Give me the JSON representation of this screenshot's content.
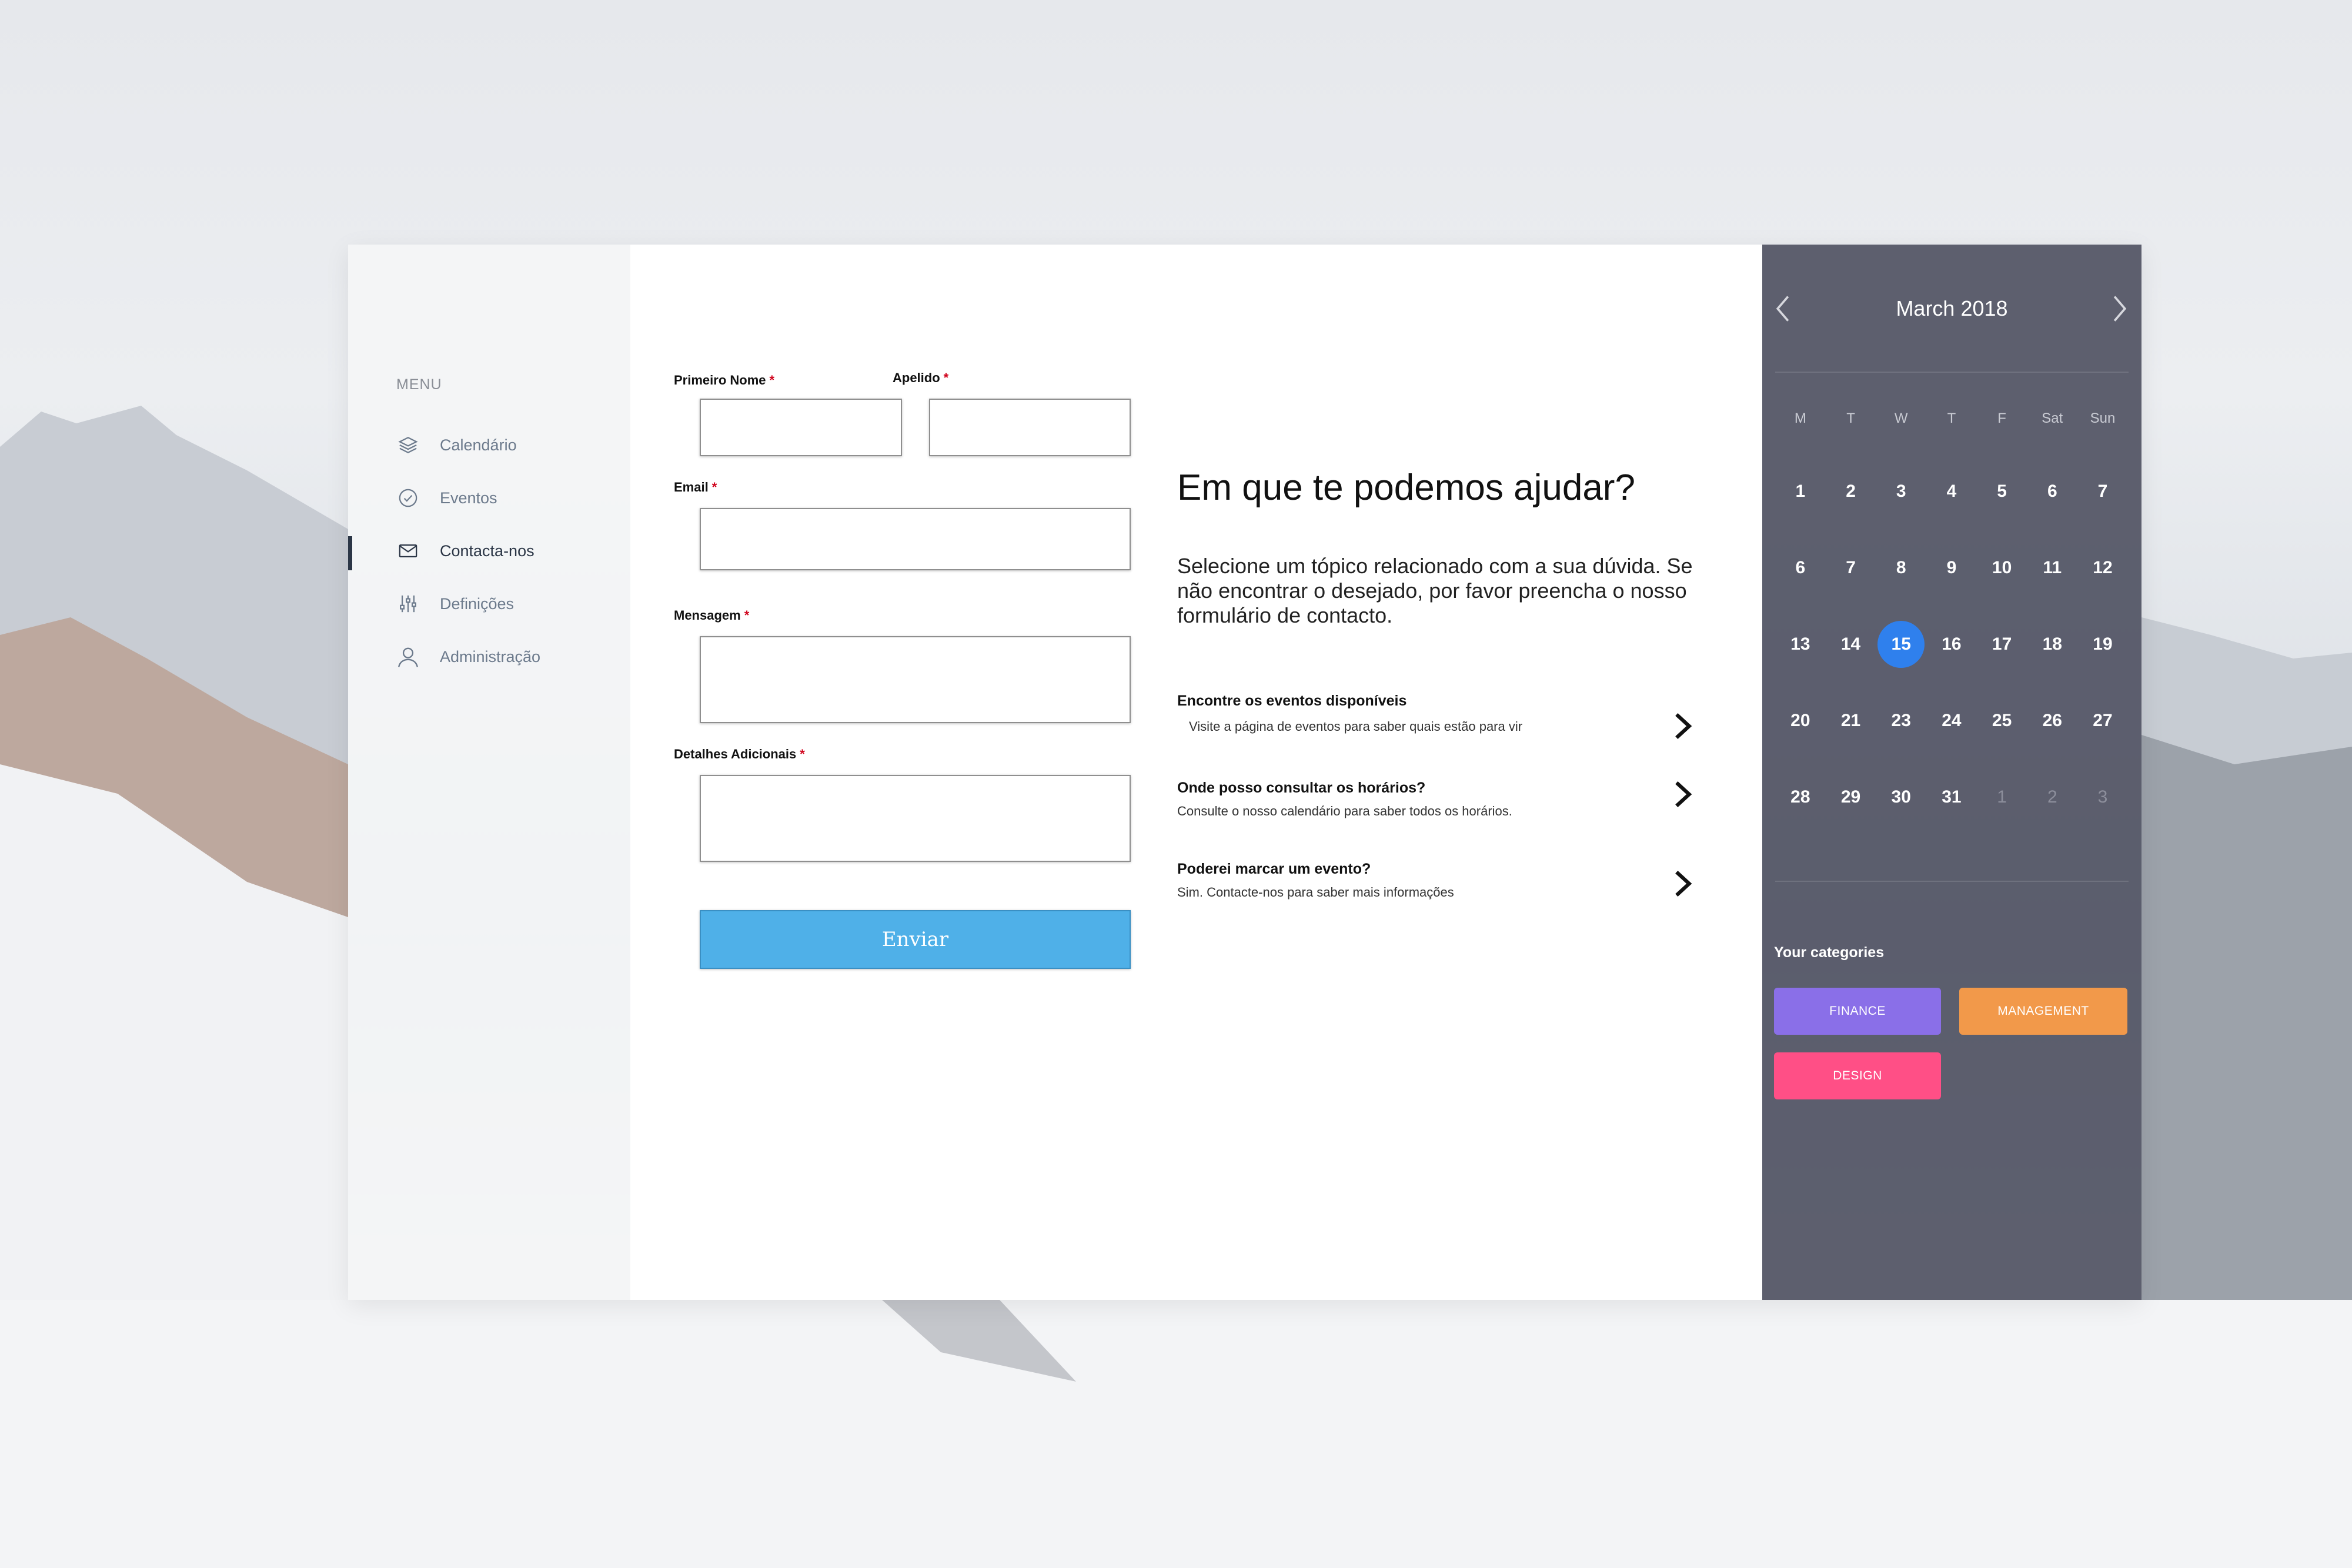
{
  "sidebar": {
    "menu_title": "MENU",
    "items": [
      {
        "label": "Calendário",
        "icon": "layers-icon"
      },
      {
        "label": "Eventos",
        "icon": "check-circle-icon"
      },
      {
        "label": "Contacta-nos",
        "icon": "mail-icon",
        "active": true
      },
      {
        "label": "Definições",
        "icon": "sliders-icon"
      },
      {
        "label": "Administração",
        "icon": "user-icon"
      }
    ]
  },
  "form": {
    "first_name_label": "Primeiro Nome",
    "last_name_label": "Apelido",
    "email_label": "Email",
    "message_label": "Mensagem",
    "details_label": "Detalhes Adicionais",
    "required_mark": "*",
    "first_name_value": "",
    "last_name_value": "",
    "email_value": "",
    "message_value": "",
    "details_value": "",
    "submit_label": "Enviar"
  },
  "help": {
    "title": "Em que te podemos ajudar?",
    "description": "Selecione um tópico relacionado com a sua dúvida. Se não encontrar o desejado, por favor preencha o nosso formulário de contacto.",
    "topics": [
      {
        "title": "Encontre os eventos disponíveis",
        "subtitle": "Visite a página de eventos para saber quais estão para vir"
      },
      {
        "title": "Onde posso consultar os horários?",
        "subtitle": "Consulte o nosso calendário para saber todos os horários."
      },
      {
        "title": "Poderei marcar um evento?",
        "subtitle": "Sim. Contacte-nos para saber mais informações"
      }
    ]
  },
  "calendar": {
    "month_label": "March 2018",
    "weekdays": [
      "M",
      "T",
      "W",
      "T",
      "F",
      "Sat",
      "Sun"
    ],
    "weeks": [
      [
        "1",
        "2",
        "3",
        "4",
        "5",
        "6",
        "7"
      ],
      [
        "6",
        "7",
        "8",
        "9",
        "10",
        "11",
        "12"
      ],
      [
        "13",
        "14",
        "15",
        "16",
        "17",
        "18",
        "19"
      ],
      [
        "20",
        "21",
        "23",
        "24",
        "25",
        "26",
        "27"
      ],
      [
        "28",
        "29",
        "30",
        "31",
        "1",
        "2",
        "3"
      ]
    ],
    "selected_day": "15",
    "muted_next_month": [
      "1",
      "2",
      "3"
    ],
    "categories_title": "Your categories",
    "categories": [
      {
        "label": "FINANCE",
        "color": "#8a6fe8"
      },
      {
        "label": "MANAGEMENT",
        "color": "#f2994a"
      },
      {
        "label": "DESIGN",
        "color": "#ff4f86"
      }
    ]
  },
  "colors": {
    "accent_blue": "#4fb0e8",
    "today_circle": "#2f80ed",
    "required_red": "#d0021b",
    "calendar_bg": "#525464"
  }
}
